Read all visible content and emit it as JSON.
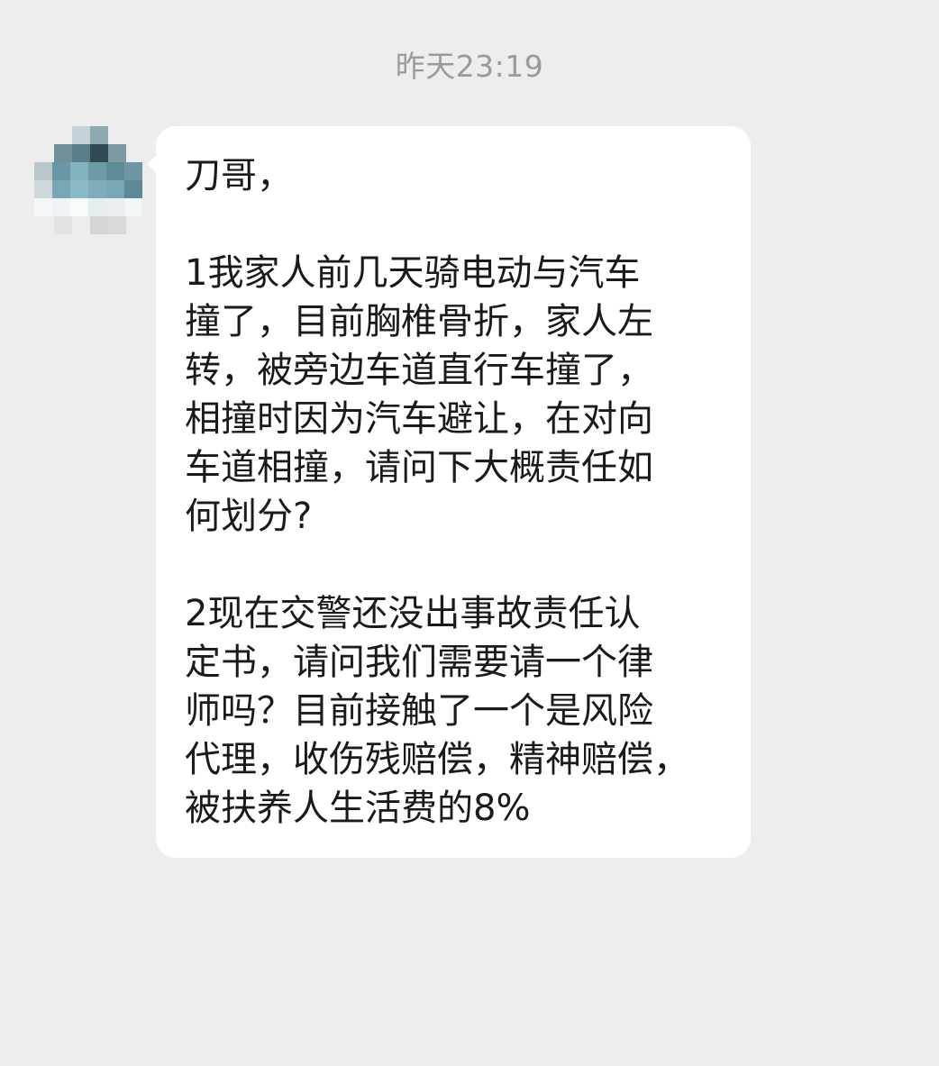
{
  "chat": {
    "timestamp": "昨天23:19",
    "message": {
      "greeting": "刀哥，",
      "paragraph1": [
        "1我家人前几天骑电动与汽车",
        "撞了，目前胸椎骨折，家人左",
        "转，被旁边车道直行车撞了，",
        "相撞时因为汽车避让，在对向",
        "车道相撞，请问下大概责任如",
        "何划分?"
      ],
      "paragraph2": [
        "2现在交警还没出事故责任认",
        "定书，请问我们需要请一个律",
        "师吗？目前接触了一个是风险",
        "代理，收伤残赔偿，精神赔偿，",
        "被扶养人生活费的8%"
      ]
    }
  },
  "colors": {
    "background": "#ededed",
    "bubble": "#ffffff",
    "text": "#1a1a1a",
    "timestamp": "#9a9a9a"
  }
}
